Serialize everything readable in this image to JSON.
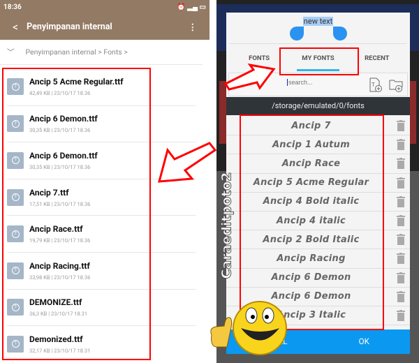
{
  "left": {
    "status": {
      "time": "18:36",
      "icons": [
        "alarm-icon",
        "signal-icon",
        "battery-icon"
      ]
    },
    "header": {
      "back_icon": "chevron-left-icon",
      "title": "Penyimpanan internal",
      "menu_icon": "more-vert-icon"
    },
    "breadcrumb": {
      "root": "Penyimpanan internal",
      "sep": ">",
      "folder": "Fonts"
    },
    "files": [
      {
        "name": "Ancip 5 Acme Regular.ttf",
        "size": "42,49 KB",
        "date": "23/10/17 18.36"
      },
      {
        "name": "Ancip 6 Demon.ttf",
        "size": "30,35 KB",
        "date": "23/10/17 18.36"
      },
      {
        "name": "Ancip 6  Demon.ttf",
        "size": "30,35 KB",
        "date": "23/10/17 18.36"
      },
      {
        "name": "Ancip 7.ttf",
        "size": "17,51 KB",
        "date": "23/10/17 18.36"
      },
      {
        "name": "Ancip Race.ttf",
        "size": "19,79 KB",
        "date": "23/10/17 18.36"
      },
      {
        "name": "Ancip Racing.ttf",
        "size": "33,98 KB",
        "date": "23/10/17 18.36"
      },
      {
        "name": "DEMONIZE.ttf",
        "size": "36,3 KB",
        "date": "23/10/17 18.31"
      },
      {
        "name": "Demonized.ttf",
        "size": "32,17 KB",
        "date": "23/10/17 18.31"
      }
    ]
  },
  "dialog": {
    "preview_text": "new text",
    "tabs": [
      {
        "label": "FONTS"
      },
      {
        "label": "MY FONTS",
        "active": true
      },
      {
        "label": "RECENT"
      }
    ],
    "search_placeholder": "search...",
    "path": "/storage/emulated/0/fonts",
    "fonts": [
      "Ancip 7",
      "Ancip 1 Autum",
      "Ancip Race",
      "Ancip 5 Acme Regular",
      "Ancip 4 Bold italic",
      "Ancip 4 italic",
      "Ancip 2 Bold Italic",
      "Ancip Racing",
      "Ancip 6 Demon",
      "Ancip 6  Demon",
      "Ancip 3 Italic"
    ],
    "cancel_label": "CANCEL",
    "ok_label": "OK"
  },
  "watermark": "Caraeditpoto2",
  "colors": {
    "appbar": "#937a64",
    "accent": "#33b5e5",
    "ok_bar": "#0b98f0",
    "highlight": "#ff0000"
  }
}
